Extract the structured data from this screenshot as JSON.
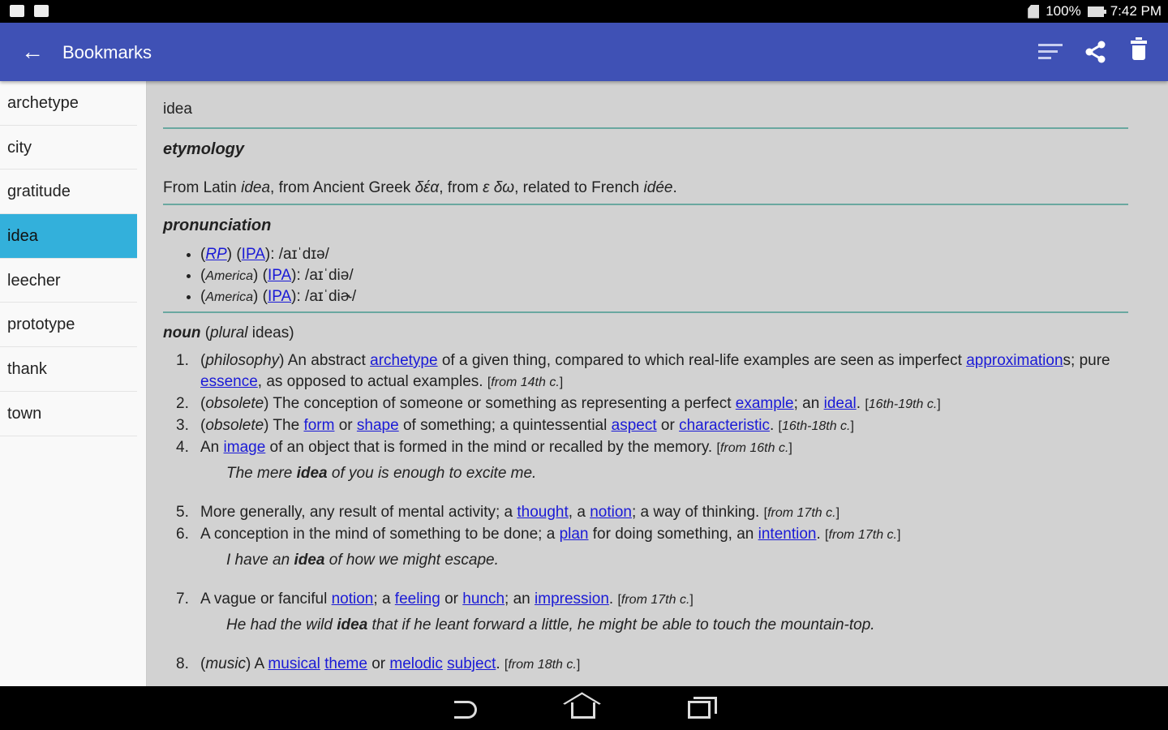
{
  "status": {
    "battery": "100%",
    "time": "7:42 PM"
  },
  "appbar": {
    "title": "Bookmarks",
    "back_icon": "arrow-left-icon",
    "actions": [
      "sort-icon",
      "share-icon",
      "delete-icon"
    ]
  },
  "colors": {
    "appbar": "#3f51b5",
    "selected": "#33b0db",
    "link": "#1a1ad6",
    "divider": "#6aa8a0"
  },
  "sidebar": {
    "selected": "idea",
    "items": [
      "archetype",
      "city",
      "gratitude",
      "idea",
      "leecher",
      "prototype",
      "thank",
      "town"
    ]
  },
  "entry": {
    "word": "idea",
    "etymology_heading": "etymology",
    "etymology": [
      {
        "t": "From Latin "
      },
      {
        "t": "idea",
        "s": "i"
      },
      {
        "t": ", from Ancient Greek  "
      },
      {
        "t": "δέα",
        "s": "i"
      },
      {
        "t": ", from "
      },
      {
        "t": "ε δω",
        "s": "i"
      },
      {
        "t": ", related to French "
      },
      {
        "t": "idée",
        "s": "i"
      },
      {
        "t": "."
      }
    ],
    "pronunciation_heading": "pronunciation",
    "pronunciations": [
      [
        {
          "t": "("
        },
        {
          "t": "RP",
          "s": "li"
        },
        {
          "t": ") ("
        },
        {
          "t": "IPA",
          "s": "l"
        },
        {
          "t": "): /aɪˈdɪə/"
        }
      ],
      [
        {
          "t": "("
        },
        {
          "t": "America",
          "s": "si"
        },
        {
          "t": ") ("
        },
        {
          "t": "IPA",
          "s": "l"
        },
        {
          "t": "): /aɪˈdiə/"
        }
      ],
      [
        {
          "t": "("
        },
        {
          "t": "America",
          "s": "si"
        },
        {
          "t": ") ("
        },
        {
          "t": "IPA",
          "s": "l"
        },
        {
          "t": "): /aɪˈdiɚ/"
        }
      ]
    ],
    "pos": [
      {
        "t": "noun",
        "s": "bi"
      },
      {
        "t": " ("
      },
      {
        "t": "plural",
        "s": "i"
      },
      {
        "t": " ideas)"
      }
    ],
    "definitions": [
      {
        "n": "1.",
        "text": [
          {
            "t": "("
          },
          {
            "t": "philosophy",
            "s": "i"
          },
          {
            "t": ") An abstract "
          },
          {
            "t": "archetype",
            "s": "l"
          },
          {
            "t": " of a given thing, compared to which real-life examples are seen as imperfect "
          },
          {
            "t": "approximation",
            "s": "l"
          },
          {
            "t": "s; pure "
          },
          {
            "t": "essence",
            "s": "l"
          },
          {
            "t": ", as opposed to actual examples. "
          },
          {
            "t": "[",
            "s": "s"
          },
          {
            "t": "from 14th c.",
            "s": "si"
          },
          {
            "t": "]",
            "s": "s"
          }
        ]
      },
      {
        "n": "2.",
        "text": [
          {
            "t": "("
          },
          {
            "t": "obsolete",
            "s": "i"
          },
          {
            "t": ") The conception of someone or something as representing a perfect "
          },
          {
            "t": "example",
            "s": "l"
          },
          {
            "t": "; an "
          },
          {
            "t": "ideal",
            "s": "l"
          },
          {
            "t": ". "
          },
          {
            "t": "[",
            "s": "s"
          },
          {
            "t": "16th-19th c.",
            "s": "si"
          },
          {
            "t": "]",
            "s": "s"
          }
        ]
      },
      {
        "n": "3.",
        "text": [
          {
            "t": "("
          },
          {
            "t": "obsolete",
            "s": "i"
          },
          {
            "t": ") The "
          },
          {
            "t": "form",
            "s": "l"
          },
          {
            "t": " or "
          },
          {
            "t": "shape",
            "s": "l"
          },
          {
            "t": " of something; a quintessential "
          },
          {
            "t": "aspect",
            "s": "l"
          },
          {
            "t": " or "
          },
          {
            "t": "characteristic",
            "s": "l"
          },
          {
            "t": ". "
          },
          {
            "t": "[",
            "s": "s"
          },
          {
            "t": "16th-18th c.",
            "s": "si"
          },
          {
            "t": "]",
            "s": "s"
          }
        ]
      },
      {
        "n": "4.",
        "text": [
          {
            "t": "An "
          },
          {
            "t": "image",
            "s": "l"
          },
          {
            "t": " of an object that is formed in the mind or recalled by the memory. "
          },
          {
            "t": "[",
            "s": "s"
          },
          {
            "t": "from 16th c.",
            "s": "si"
          },
          {
            "t": "]",
            "s": "s"
          }
        ],
        "example": [
          {
            "t": "The mere "
          },
          {
            "t": "idea",
            "s": "b"
          },
          {
            "t": " of you is enough to excite me."
          }
        ]
      },
      {
        "n": "5.",
        "text": [
          {
            "t": "More generally, any result of mental activity; a "
          },
          {
            "t": "thought",
            "s": "l"
          },
          {
            "t": ", a "
          },
          {
            "t": "notion",
            "s": "l"
          },
          {
            "t": "; a way of thinking. "
          },
          {
            "t": "[",
            "s": "s"
          },
          {
            "t": "from 17th c.",
            "s": "si"
          },
          {
            "t": "]",
            "s": "s"
          }
        ]
      },
      {
        "n": "6.",
        "text": [
          {
            "t": "A conception in the mind of something to be done; a "
          },
          {
            "t": "plan",
            "s": "l"
          },
          {
            "t": " for doing something, an "
          },
          {
            "t": "intention",
            "s": "l"
          },
          {
            "t": ". "
          },
          {
            "t": "[",
            "s": "s"
          },
          {
            "t": "from 17th c.",
            "s": "si"
          },
          {
            "t": "]",
            "s": "s"
          }
        ],
        "example": [
          {
            "t": "I have an "
          },
          {
            "t": "idea",
            "s": "b"
          },
          {
            "t": " of how we might escape."
          }
        ]
      },
      {
        "n": "7.",
        "text": [
          {
            "t": "A vague or fanciful "
          },
          {
            "t": "notion",
            "s": "l"
          },
          {
            "t": "; a "
          },
          {
            "t": "feeling",
            "s": "l"
          },
          {
            "t": " or "
          },
          {
            "t": "hunch",
            "s": "l"
          },
          {
            "t": "; an "
          },
          {
            "t": "impression",
            "s": "l"
          },
          {
            "t": ". "
          },
          {
            "t": "[",
            "s": "s"
          },
          {
            "t": "from 17th c.",
            "s": "si"
          },
          {
            "t": "]",
            "s": "s"
          }
        ],
        "example": [
          {
            "t": "He had the wild "
          },
          {
            "t": "idea",
            "s": "b"
          },
          {
            "t": " that if he leant forward a little, he might be able to touch the mountain-top."
          }
        ]
      },
      {
        "n": "8.",
        "text": [
          {
            "t": "("
          },
          {
            "t": "music",
            "s": "i"
          },
          {
            "t": ") A "
          },
          {
            "t": "musical",
            "s": "l"
          },
          {
            "t": " "
          },
          {
            "t": "theme",
            "s": "l"
          },
          {
            "t": " or "
          },
          {
            "t": "melodic",
            "s": "l"
          },
          {
            "t": " "
          },
          {
            "t": "subject",
            "s": "l"
          },
          {
            "t": ". "
          },
          {
            "t": "[",
            "s": "s"
          },
          {
            "t": "from 18th c.",
            "s": "si"
          },
          {
            "t": "]",
            "s": "s"
          }
        ]
      }
    ]
  }
}
